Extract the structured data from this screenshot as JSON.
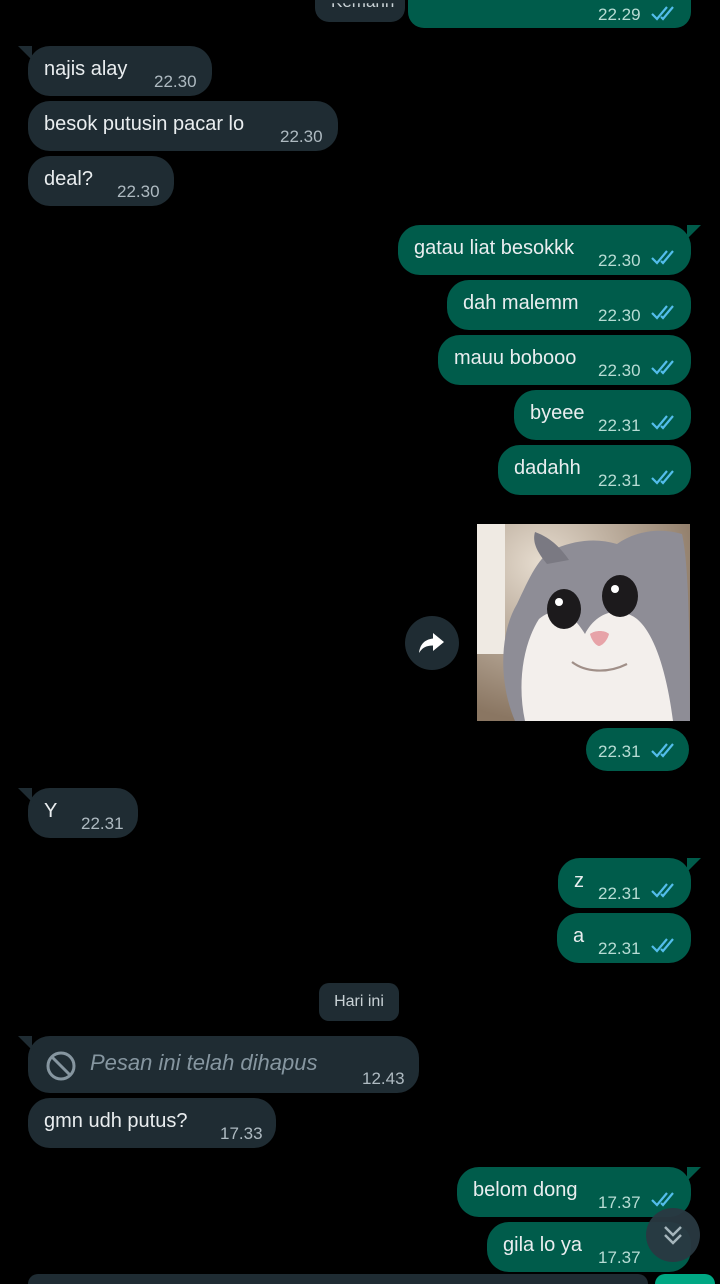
{
  "colors": {
    "background": "#000000",
    "incoming_bubble": "#1f2c33",
    "outgoing_bubble": "#005c4b",
    "read_ticks": "#53bdeb"
  },
  "top_partial": {
    "incoming_text": "Kemarin",
    "outgoing_time": "22.29"
  },
  "messages": [
    {
      "direction": "in",
      "text": "najis alay",
      "time": "22.30"
    },
    {
      "direction": "in",
      "text": "besok putusin pacar lo",
      "time": "22.30"
    },
    {
      "direction": "in",
      "text": "deal?",
      "time": "22.30"
    },
    {
      "direction": "out",
      "text": "gatau liat besokkk",
      "time": "22.30",
      "status": "read"
    },
    {
      "direction": "out",
      "text": "dah malemm",
      "time": "22.30",
      "status": "read"
    },
    {
      "direction": "out",
      "text": "mauu bobooo",
      "time": "22.30",
      "status": "read"
    },
    {
      "direction": "out",
      "text": "byeee",
      "time": "22.31",
      "status": "read"
    },
    {
      "direction": "out",
      "text": "dadahh",
      "time": "22.31",
      "status": "read"
    },
    {
      "direction": "out",
      "type": "image",
      "image": "cat photo",
      "time": "22.31",
      "status": "read"
    },
    {
      "direction": "in",
      "text": "Y",
      "time": "22.31"
    },
    {
      "direction": "out",
      "text": "z",
      "time": "22.31",
      "status": "read"
    },
    {
      "direction": "out",
      "text": "a",
      "time": "22.31",
      "status": "read"
    },
    {
      "direction": "in",
      "type": "deleted",
      "text": "Pesan ini telah dihapus",
      "time": "12.43"
    },
    {
      "direction": "in",
      "text": "gmn udh putus?",
      "time": "17.33"
    },
    {
      "direction": "out",
      "text": "belom dong",
      "time": "17.37",
      "status": "read"
    },
    {
      "direction": "out",
      "text": "gila lo ya",
      "time": "17.37",
      "status": "read"
    }
  ],
  "date_separator": "Hari ini",
  "icons": {
    "forward": "share-arrow-icon",
    "scroll_down": "double-chevron-down-icon",
    "deleted": "no-entry-icon"
  }
}
